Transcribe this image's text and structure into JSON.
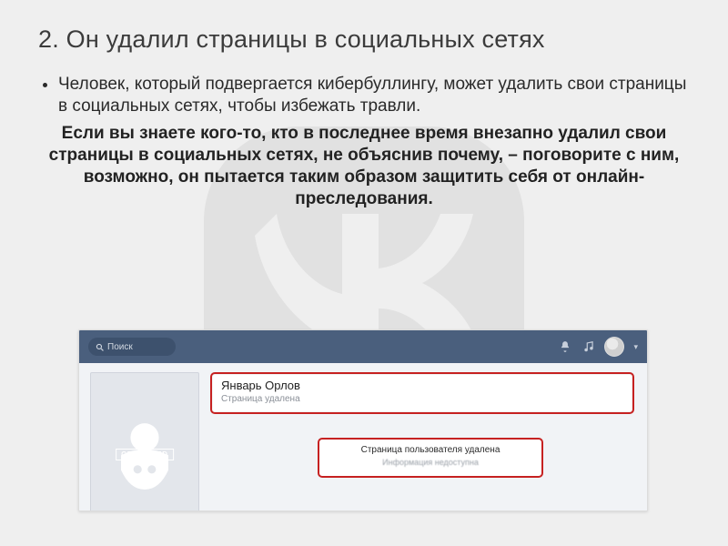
{
  "title": "2. Он удалил страницы в социальных сетях",
  "bullet": "Человек, который подвергается кибербуллингу, может удалить свои страницы в социальных сетях, чтобы избежать травли.",
  "bold_paragraph": "Если вы знаете кого-то, кто в последнее время внезапно удалил свои страницы в социальных сетях, не объяснив почему, – поговорите с ним, возможно, он пытается таким образом защитить себя от онлайн-преследования.",
  "browser": {
    "search_placeholder": "Поиск",
    "censored_label": "CENSORED",
    "user_name": "Январь Орлов",
    "user_status": "Страница удалена",
    "deleted_title": "Страница пользователя удалена",
    "deleted_sub": "Информация недоступна"
  }
}
